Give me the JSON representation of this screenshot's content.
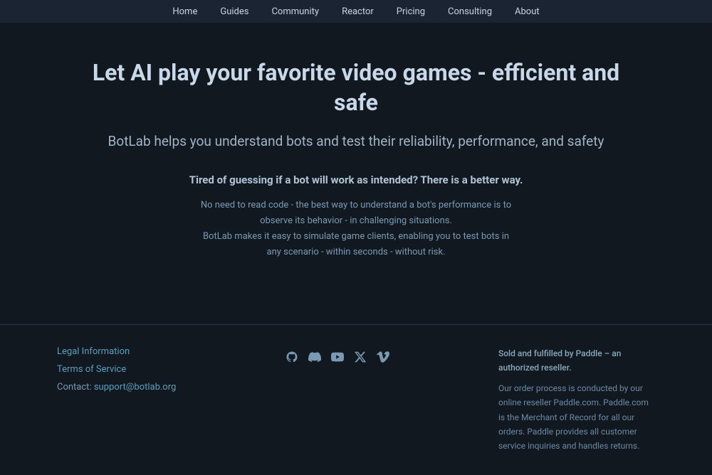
{
  "nav": {
    "items": [
      {
        "label": "Home",
        "id": "home"
      },
      {
        "label": "Guides",
        "id": "guides"
      },
      {
        "label": "Community",
        "id": "community"
      },
      {
        "label": "Reactor",
        "id": "reactor"
      },
      {
        "label": "Pricing",
        "id": "pricing"
      },
      {
        "label": "Consulting",
        "id": "consulting"
      },
      {
        "label": "About",
        "id": "about"
      }
    ]
  },
  "hero": {
    "h1": "Let AI play your favorite video games - efficient and safe",
    "h2": "BotLab helps you understand bots and test their reliability, performance, and safety",
    "h3": "Tired of guessing if a bot will work as intended? There is a better way.",
    "p1": "No need to read code - the best way to understand a bot's performance is to observe its behavior - in challenging situations.",
    "p2": "BotLab makes it easy to simulate game clients, enabling you to test bots in any scenario - within seconds - without risk."
  },
  "footer": {
    "legal_link": "Legal Information",
    "tos_link": "Terms of Service",
    "contact_label": "Contact:",
    "contact_email": "support@botlab.org",
    "paddle_text": "Sold and fulfilled by Paddle – an authorized reseller.",
    "paddle_detail": "Our order process is conducted by our online reseller Paddle.com. Paddle.com is the Merchant of Record for all our orders. Paddle provides all customer service inquiries and handles returns.",
    "social": {
      "github": "⌥",
      "discord": "◈",
      "youtube": "▶",
      "twitter": "𝕏",
      "vimeo": "▷"
    }
  }
}
